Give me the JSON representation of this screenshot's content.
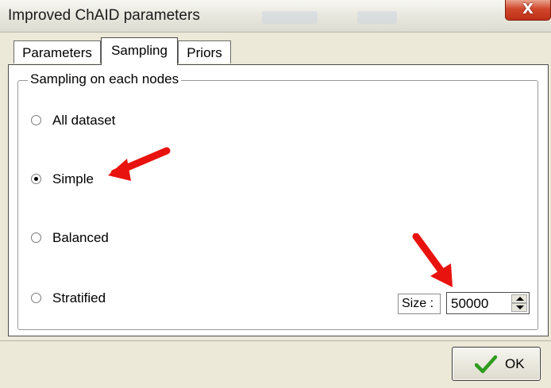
{
  "window": {
    "title": "Improved ChAID parameters",
    "close_symbol": "X"
  },
  "tabs": [
    {
      "label": "Parameters",
      "active": false
    },
    {
      "label": "Sampling",
      "active": true
    },
    {
      "label": "Priors",
      "active": false
    }
  ],
  "sampling": {
    "group_title": "Sampling on each nodes",
    "options": [
      {
        "label": "All dataset",
        "checked": false
      },
      {
        "label": "Simple",
        "checked": true
      },
      {
        "label": "Balanced",
        "checked": false
      },
      {
        "label": "Stratified",
        "checked": false
      }
    ],
    "size_label": "Size :",
    "size_value": "50000"
  },
  "buttons": {
    "ok_label": "OK"
  },
  "colors": {
    "annotation_arrow": "#e8130f",
    "ok_check": "#2e9b1e",
    "close_button": "#c9391c"
  },
  "icons": {
    "ok": "check-icon",
    "close": "close-icon",
    "spinner": "spin-arrows-icon"
  }
}
